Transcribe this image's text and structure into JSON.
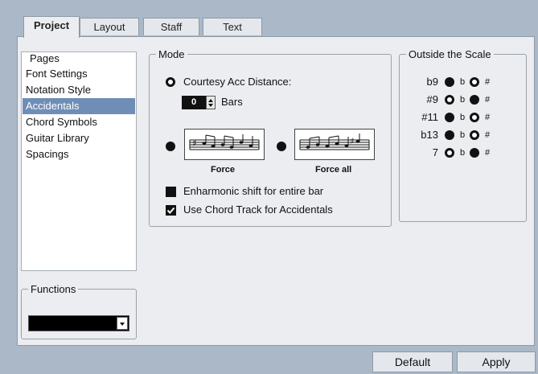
{
  "tabs": [
    {
      "label": "Project",
      "active": true
    },
    {
      "label": "Layout",
      "active": false
    },
    {
      "label": "Staff",
      "active": false
    },
    {
      "label": "Text",
      "active": false
    }
  ],
  "pages": {
    "title": "Pages",
    "items": [
      "Font Settings",
      "Notation Style",
      "Accidentals",
      "Chord Symbols",
      "Guitar Library",
      "Spacings"
    ],
    "selected": "Accidentals"
  },
  "functions": {
    "title": "Functions",
    "value": ""
  },
  "mode": {
    "title": "Mode",
    "courtesy_label": "Courtesy Acc Distance:",
    "bars_value": "0",
    "bars_label": "Bars",
    "force_label": "Force",
    "force_all_label": "Force all",
    "enharmonic_label": "Enharmonic shift for entire bar",
    "enharmonic_checked": false,
    "chord_track_label": "Use Chord Track for Accidentals",
    "chord_track_checked": true
  },
  "outside": {
    "title": "Outside the Scale",
    "flat_label": "b",
    "sharp_label": "#",
    "rows": [
      {
        "label": "b9",
        "choice": "b"
      },
      {
        "label": "#9",
        "choice": "#"
      },
      {
        "label": "#11",
        "choice": "b"
      },
      {
        "label": "b13",
        "choice": "b"
      },
      {
        "label": "7",
        "choice": "#"
      }
    ]
  },
  "buttons": {
    "default": "Default",
    "apply": "Apply"
  },
  "colors": {
    "background": "#aab8c8",
    "panel": "#ebedf0",
    "selection": "#6e8eb7"
  }
}
